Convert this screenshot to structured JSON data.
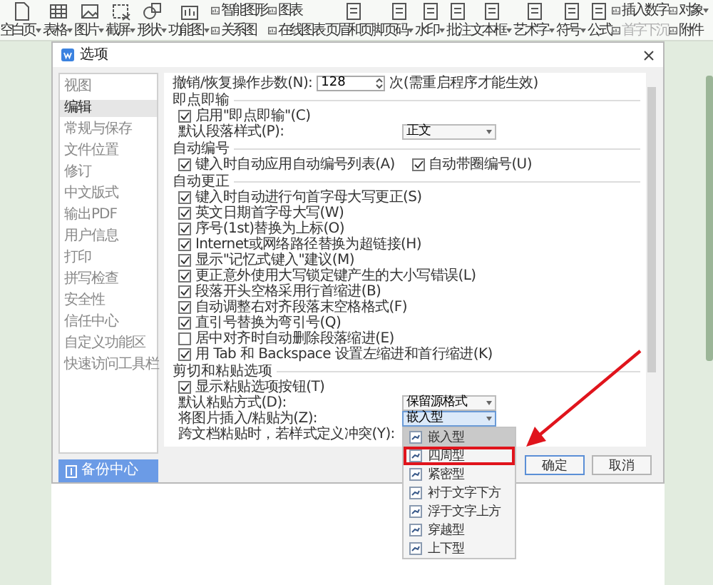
{
  "toolbar": [
    {
      "kind": "large",
      "label": "空白页",
      "caret": true
    },
    {
      "kind": "large",
      "label": "表格",
      "caret": true
    },
    {
      "kind": "large",
      "label": "图片",
      "caret": true
    },
    {
      "kind": "large",
      "label": "截屏",
      "caret": true
    },
    {
      "kind": "large",
      "label": "形状",
      "caret": true
    },
    {
      "kind": "large",
      "label": "功能图",
      "caret": true
    },
    {
      "kind": "pair",
      "items": [
        {
          "label": "智能图形",
          "caret": false,
          "disabled": false
        },
        {
          "label": "关系图",
          "caret": false,
          "disabled": false
        }
      ]
    },
    {
      "kind": "pair",
      "items": [
        {
          "label": "图表",
          "caret": false,
          "disabled": false
        },
        {
          "label": "在线图表",
          "caret": false,
          "disabled": false
        }
      ]
    },
    {
      "kind": "large",
      "label": "页眉和页脚",
      "caret": false
    },
    {
      "kind": "large",
      "label": "页码",
      "caret": true
    },
    {
      "kind": "large",
      "label": "水印",
      "caret": true
    },
    {
      "kind": "large",
      "label": "批注",
      "caret": false
    },
    {
      "kind": "large",
      "label": "文本框",
      "caret": true
    },
    {
      "kind": "large",
      "label": "艺术字",
      "caret": true
    },
    {
      "kind": "large",
      "label": "符号",
      "caret": true
    },
    {
      "kind": "large",
      "label": "公式",
      "caret": false
    },
    {
      "kind": "pair",
      "items": [
        {
          "label": "插入数字",
          "caret": false,
          "disabled": false
        },
        {
          "label": "首字下沉",
          "caret": false,
          "disabled": true
        }
      ]
    },
    {
      "kind": "pair",
      "items": [
        {
          "label": "对象",
          "caret": true,
          "disabled": false
        },
        {
          "label": "附件",
          "caret": false,
          "disabled": false
        }
      ]
    }
  ],
  "dialog": {
    "title": "选项",
    "nav": [
      {
        "label": "视图",
        "selected": false
      },
      {
        "label": "编辑",
        "selected": true
      },
      {
        "label": "常规与保存",
        "selected": false
      },
      {
        "label": "文件位置",
        "selected": false
      },
      {
        "label": "修订",
        "selected": false
      },
      {
        "label": "中文版式",
        "selected": false
      },
      {
        "label": "输出PDF",
        "selected": false
      },
      {
        "label": "用户信息",
        "selected": false
      },
      {
        "label": "打印",
        "selected": false
      },
      {
        "label": "拼写检查",
        "selected": false
      },
      {
        "label": "安全性",
        "selected": false
      },
      {
        "label": "信任中心",
        "selected": false
      },
      {
        "label": "自定义功能区",
        "selected": false
      },
      {
        "label": "快速访问工具栏",
        "selected": false
      }
    ],
    "backup_button": "备份中心",
    "sections": [
      {
        "rows": [
          {
            "kind": "spin",
            "label": "撤销/恢复操作步数(N):",
            "value": "128",
            "suffix": "次(需重启程序才能生效)"
          }
        ]
      },
      {
        "title": "即点即输",
        "rows": [
          {
            "kind": "check",
            "label": "启用\"即点即输\"(C)",
            "checked": true
          },
          {
            "kind": "select",
            "label": "默认段落样式(P):",
            "value": "正文",
            "open": false
          }
        ]
      },
      {
        "title": "自动编号",
        "rows": [
          {
            "kind": "check_pair",
            "items": [
              {
                "label": "键入时自动应用自动编号列表(A)",
                "checked": true
              },
              {
                "label": "自动带圈编号(U)",
                "checked": true
              }
            ]
          }
        ]
      },
      {
        "title": "自动更正",
        "rows": [
          {
            "kind": "check",
            "label": "键入时自动进行句首字母大写更正(S)",
            "checked": true
          },
          {
            "kind": "check",
            "label": "英文日期首字母大写(W)",
            "checked": true
          },
          {
            "kind": "check",
            "label": "序号(1st)替换为上标(O)",
            "checked": true
          },
          {
            "kind": "check",
            "label": "Internet或网络路径替换为超链接(H)",
            "checked": true
          },
          {
            "kind": "check",
            "label": "显示\"记忆式键入\"建议(M)",
            "checked": true
          },
          {
            "kind": "check",
            "label": "更正意外使用大写锁定键产生的大小写错误(L)",
            "checked": true
          },
          {
            "kind": "check",
            "label": "段落开头空格采用行首缩进(B)",
            "checked": true
          },
          {
            "kind": "check",
            "label": "自动调整右对齐段落末空格格式(F)",
            "checked": true
          },
          {
            "kind": "check",
            "label": "直引号替换为弯引号(Q)",
            "checked": true
          },
          {
            "kind": "check",
            "label": "居中对齐时自动删除段落缩进(E)",
            "checked": false
          },
          {
            "kind": "check",
            "label": "用 Tab 和 Backspace 设置左缩进和首行缩进(K)",
            "checked": true
          }
        ]
      },
      {
        "title": "剪切和粘贴选项",
        "rows": [
          {
            "kind": "check",
            "label": "显示粘贴选项按钮(T)",
            "checked": true
          },
          {
            "kind": "select",
            "label": "默认粘贴方式(D):",
            "value": "保留源格式",
            "open": false
          },
          {
            "kind": "select",
            "label": "将图片插入/粘贴为(Z):",
            "value": "嵌入型",
            "open": true,
            "options": [
              {
                "label": "嵌入型",
                "selected": true,
                "annotated": false
              },
              {
                "label": "四周型",
                "selected": false,
                "annotated": true
              },
              {
                "label": "紧密型",
                "selected": false,
                "annotated": false
              },
              {
                "label": "衬于文字下方",
                "selected": false,
                "annotated": false
              },
              {
                "label": "浮于文字上方",
                "selected": false,
                "annotated": false
              },
              {
                "label": "穿越型",
                "selected": false,
                "annotated": false
              },
              {
                "label": "上下型",
                "selected": false,
                "annotated": false
              }
            ]
          },
          {
            "kind": "text",
            "label": "跨文档粘贴时，若样式定义冲突(Y):"
          }
        ]
      }
    ],
    "buttons": [
      {
        "label": "确定",
        "default": true
      },
      {
        "label": "取消",
        "default": false
      }
    ]
  }
}
